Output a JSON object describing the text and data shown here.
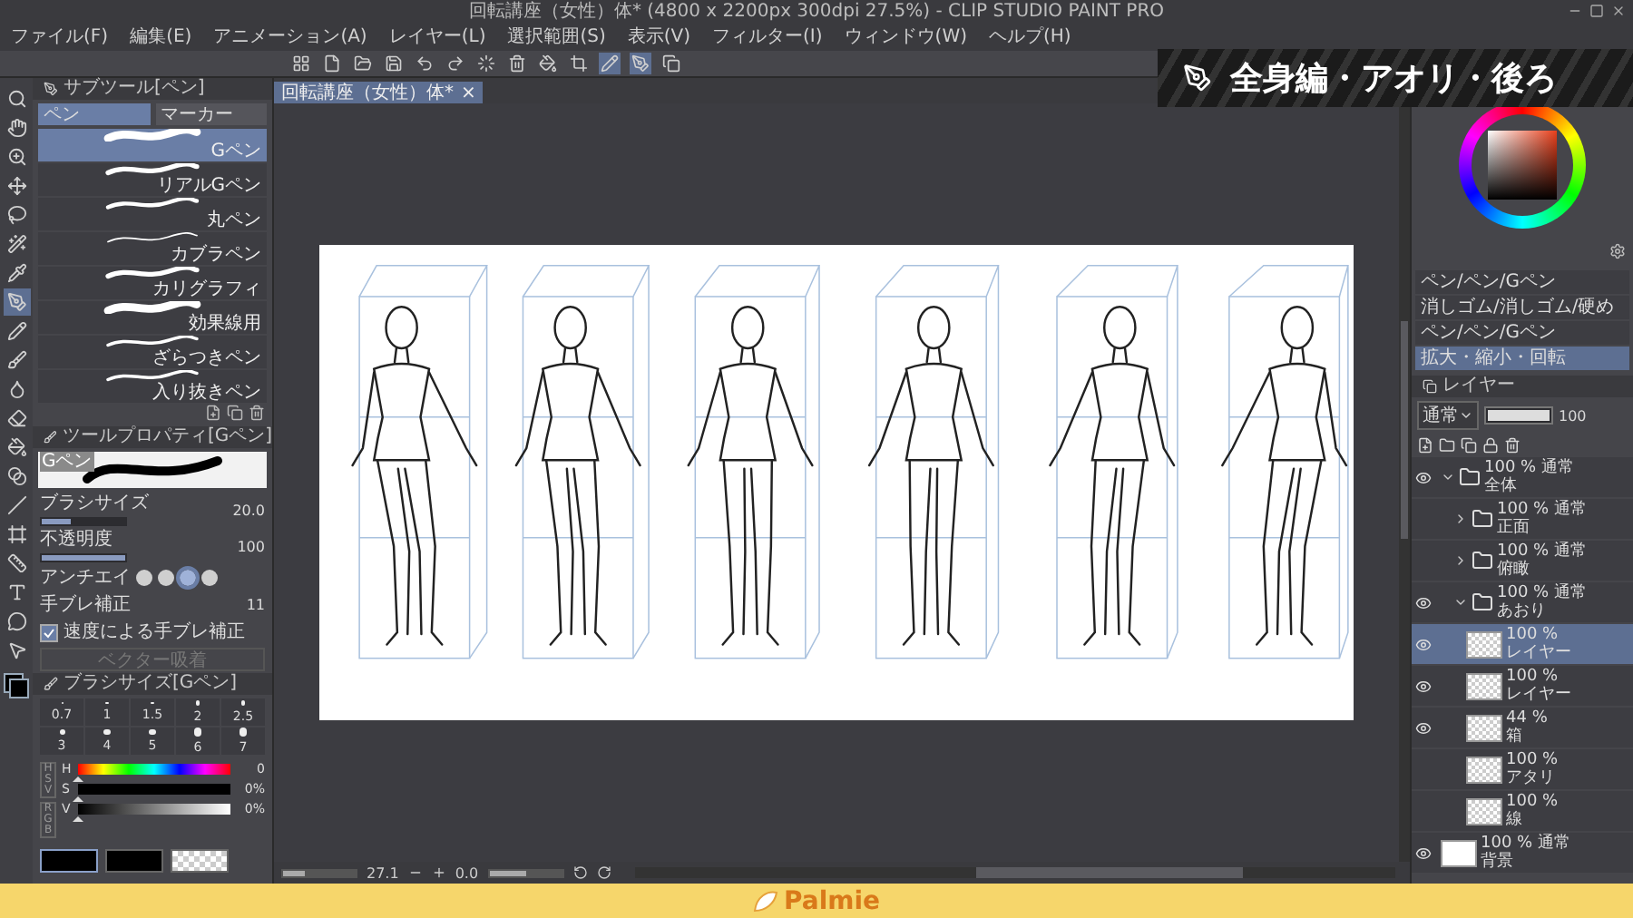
{
  "window": {
    "title": "回転講座（女性）体* (4800 x 2200px 300dpi 27.5%) - CLIP STUDIO PAINT PRO"
  },
  "menu": [
    "ファイル(F)",
    "編集(E)",
    "アニメーション(A)",
    "レイヤー(L)",
    "選択範囲(S)",
    "表示(V)",
    "フィルター(I)",
    "ウィンドウ(W)",
    "ヘルプ(H)"
  ],
  "banner": {
    "title": "全身編・アオリ・後ろ"
  },
  "tools": [
    {
      "selected": false
    },
    {
      "selected": false
    },
    {
      "selected": false
    },
    {
      "selected": false
    },
    {
      "selected": false
    },
    {
      "selected": false
    },
    {
      "selected": false
    },
    {
      "selected": true
    },
    {
      "selected": false
    },
    {
      "selected": false
    },
    {
      "selected": false
    },
    {
      "selected": false
    },
    {
      "selected": false
    },
    {
      "selected": false
    },
    {
      "selected": false
    },
    {
      "selected": false
    },
    {
      "selected": false
    },
    {
      "selected": false
    },
    {
      "selected": false
    },
    {
      "selected": false
    }
  ],
  "sub_tool_panel": {
    "title": "サブツール[ペン]",
    "tabs": [
      {
        "label": "ペン",
        "selected": true
      },
      {
        "label": "マーカー",
        "selected": false
      }
    ],
    "brushes": [
      {
        "name": "Gペン",
        "selected": true
      },
      {
        "name": "リアルGペン",
        "selected": false
      },
      {
        "name": "丸ペン",
        "selected": false
      },
      {
        "name": "カブラペン",
        "selected": false
      },
      {
        "name": "カリグラフィ",
        "selected": false
      },
      {
        "name": "効果線用",
        "selected": false
      },
      {
        "name": "ざらつきペン",
        "selected": false
      },
      {
        "name": "入り抜きペン",
        "selected": false
      }
    ]
  },
  "tool_property": {
    "title": "ツールプロパティ[Gペン]",
    "preview_label": "Gペン",
    "rows": [
      {
        "kind": "slider",
        "label": "ブラシサイズ",
        "value": "20.0",
        "level": 0.35
      },
      {
        "kind": "slider",
        "label": "不透明度",
        "value": "100",
        "level": 1
      },
      {
        "kind": "options",
        "label": "アンチエイ",
        "options": [
          {
            "selected": false
          },
          {
            "selected": false
          },
          {
            "selected": true
          },
          {
            "selected": false
          }
        ]
      },
      {
        "kind": "value",
        "label": "手ブレ補正",
        "value": "11"
      },
      {
        "kind": "checkbox",
        "label": "速度による手ブレ補正",
        "checked": true
      },
      {
        "kind": "button",
        "label": "ベクター吸着",
        "disabled": true
      }
    ]
  },
  "brush_size_panel": {
    "title": "ブラシサイズ[Gペン]",
    "sizes": [
      "0.7",
      "1",
      "1.5",
      "2",
      "2.5",
      "3",
      "4",
      "5",
      "6",
      "7"
    ]
  },
  "color_panel": {
    "modes": [
      "HSV",
      "RGB"
    ],
    "channels": [
      {
        "kind": "hue",
        "label": "H",
        "value": "0",
        "level": 0
      },
      {
        "kind": "saturation",
        "label": "S",
        "value": "0%",
        "level": 0
      },
      {
        "kind": "value",
        "label": "V",
        "value": "0%",
        "level": 0
      }
    ]
  },
  "document_tab": {
    "label": "回転講座（女性）体*",
    "close": "×"
  },
  "status_bar": {
    "zoom": "27.1",
    "zoom_slider": {
      "level": 0.3
    },
    "angle": "0.0",
    "angle_slider": {
      "level": 0.5
    }
  },
  "sub_view": {
    "items": [
      {
        "label": "ペン/ペン/Gペン",
        "selected": false
      },
      {
        "label": "消しゴム/消しゴム/硬め",
        "selected": false
      },
      {
        "label": "ペン/ペン/Gペン",
        "selected": false
      },
      {
        "label": "拡大・縮小・回転",
        "selected": true
      }
    ]
  },
  "layer_panel": {
    "tab": "レイヤー",
    "blend": "通常",
    "opacity": "100",
    "opacity_slider": {
      "level": 1
    },
    "layers": [
      {
        "kind": "folder",
        "opacity": "100 %",
        "blend": "通常",
        "name": "全体",
        "visible": true,
        "selected": false,
        "expanded": true,
        "children": [
          {
            "kind": "folder",
            "opacity": "100 %",
            "blend": "通常",
            "name": "正面",
            "visible": false,
            "selected": false,
            "expanded": false
          },
          {
            "kind": "folder",
            "opacity": "100 %",
            "blend": "通常",
            "name": "俯瞰",
            "visible": false,
            "selected": false,
            "expanded": false
          },
          {
            "kind": "folder",
            "opacity": "100 %",
            "blend": "通常",
            "name": "あおり",
            "visible": true,
            "selected": false,
            "expanded": true,
            "children": [
              {
                "kind": "layer",
                "opacity": "100 %",
                "name": "レイヤー",
                "visible": true,
                "selected": true
              },
              {
                "kind": "layer",
                "opacity": "100 %",
                "name": "レイヤー",
                "visible": true,
                "selected": false
              },
              {
                "kind": "layer",
                "opacity": "44 %",
                "name": "箱",
                "visible": true,
                "selected": false
              },
              {
                "kind": "layer",
                "opacity": "100 %",
                "name": "アタリ",
                "visible": false,
                "selected": false
              },
              {
                "kind": "layer",
                "opacity": "100 %",
                "name": "線",
                "visible": false,
                "selected": false
              }
            ]
          }
        ]
      },
      {
        "kind": "paper",
        "opacity": "100 %",
        "blend": "通常",
        "name": "背景",
        "visible": true,
        "selected": false
      }
    ]
  },
  "footer": {
    "brand": "Palmie"
  }
}
